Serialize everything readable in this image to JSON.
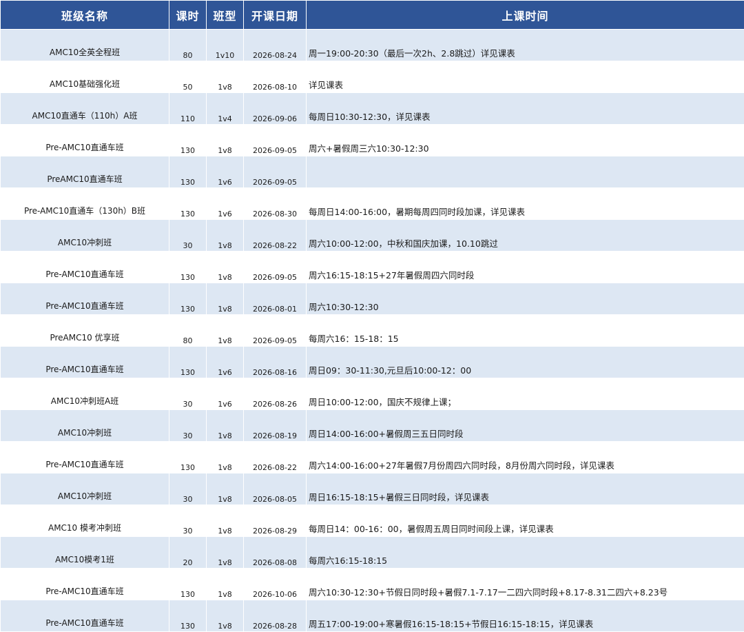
{
  "headers": {
    "name": "班级名称",
    "hours": "课时",
    "type": "班型",
    "start": "开课日期",
    "time": "上课时间"
  },
  "rows": [
    {
      "name": "AMC10全英全程班",
      "hours": "80",
      "type": "1v10",
      "start": "2026-08-24",
      "time": "周一19:00-20:30（最后一次2h、2.8跳过）详见课表"
    },
    {
      "name": "AMC10基础强化班",
      "hours": "50",
      "type": "1v8",
      "start": "2026-08-10",
      "time": "详见课表"
    },
    {
      "name": "AMC10直通车（110h）A班",
      "hours": "110",
      "type": "1v4",
      "start": "2026-09-06",
      "time": "每周日10:30-12:30，详见课表"
    },
    {
      "name": "Pre-AMC10直通车班",
      "hours": "130",
      "type": "1v8",
      "start": "2026-09-05",
      "time": "周六+暑假周三六10:30-12:30"
    },
    {
      "name": "PreAMC10直通车班",
      "hours": "130",
      "type": "1v6",
      "start": "2026-09-05",
      "time": ""
    },
    {
      "name": "Pre-AMC10直通车（130h）B班",
      "hours": "130",
      "type": "1v6",
      "start": "2026-08-30",
      "time": "每周日14:00-16:00，暑期每周四同时段加课，详见课表"
    },
    {
      "name": "AMC10冲刺班",
      "hours": "30",
      "type": "1v8",
      "start": "2026-08-22",
      "time": "周六10:00-12:00，中秋和国庆加课，10.10跳过"
    },
    {
      "name": "Pre-AMC10直通车班",
      "hours": "130",
      "type": "1v8",
      "start": "2026-09-05",
      "time": "周六16:15-18:15+27年暑假周四六同时段"
    },
    {
      "name": "Pre-AMC10直通车班",
      "hours": "130",
      "type": "1v8",
      "start": "2026-08-01",
      "time": "周六10:30-12:30"
    },
    {
      "name": "PreAMC10 优享班",
      "hours": "80",
      "type": "1v8",
      "start": "2026-09-05",
      "time": "每周六16：15-18：15"
    },
    {
      "name": "Pre-AMC10直通车班",
      "hours": "130",
      "type": "1v6",
      "start": "2026-08-16",
      "time": "周日09：30-11:30,元旦后10:00-12：00"
    },
    {
      "name": "AMC10冲刺班A班",
      "hours": "30",
      "type": "1v6",
      "start": "2026-08-26",
      "time": "周日10:00-12:00，国庆不规律上课；"
    },
    {
      "name": "AMC10冲刺班",
      "hours": "30",
      "type": "1v8",
      "start": "2026-08-19",
      "time": "周日14:00-16:00+暑假周三五日同时段"
    },
    {
      "name": "Pre-AMC10直通车班",
      "hours": "130",
      "type": "1v8",
      "start": "2026-08-22",
      "time": "周六14:00-16:00+27年暑假7月份周四六同时段，8月份周六同时段，详见课表"
    },
    {
      "name": "AMC10冲刺班",
      "hours": "30",
      "type": "1v8",
      "start": "2026-08-05",
      "time": "周日16:15-18:15+暑假三日同时段，详见课表"
    },
    {
      "name": "AMC10 模考冲刺班",
      "hours": "30",
      "type": "1v8",
      "start": "2026-08-29",
      "time": "每周日14：00-16：00，暑假周五周日同时间段上课，详见课表"
    },
    {
      "name": "AMC10模考1班",
      "hours": "20",
      "type": "1v8",
      "start": "2026-08-08",
      "time": "每周六16:15-18:15"
    },
    {
      "name": "Pre-AMC10直通车班",
      "hours": "130",
      "type": "1v8",
      "start": "2026-10-06",
      "time": "周六10:30-12:30+节假日同时段+暑假7.1-7.17一二四六同时段+8.17-8.31二四六+8.23号"
    },
    {
      "name": "Pre-AMC10直通车班",
      "hours": "130",
      "type": "1v8",
      "start": "2026-08-28",
      "time": "周五17:00-19:00+寒暑假16:15-18:15+节假日16:15-18:15，详见课表"
    }
  ]
}
